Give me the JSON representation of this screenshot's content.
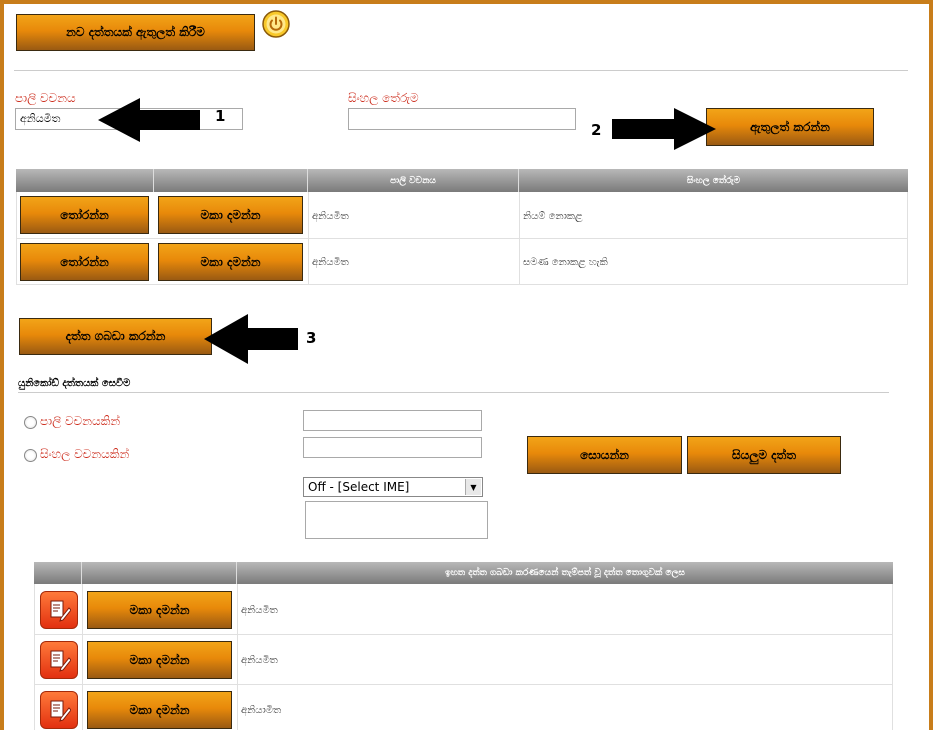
{
  "top": {
    "add_new_label": "නව දත්තයක් ඇතුලත් කිරීම"
  },
  "form": {
    "pali_label": "පාලි වචනය",
    "pali_value": "අනියමිත",
    "sinhala_label": "සිංහල තේරුම",
    "sinhala_value": "",
    "submit_label": "ඇතුලත් කරන්න"
  },
  "annotations": {
    "one": "1",
    "two": "2",
    "three": "3"
  },
  "table1": {
    "headers": [
      "",
      "",
      "පාලි වචනය",
      "සිංහල තේරුම"
    ],
    "select_label": "තෝරන්න",
    "delete_label": "මකා දමන්න",
    "rows": [
      {
        "pali": "අනියමිත",
        "sinhala": "නියම් නොකළ"
      },
      {
        "pali": "අනියමිත",
        "sinhala": "සමණ නොකළ හැකි"
      }
    ]
  },
  "save_label": "දත්ත ගබඩා කරන්න",
  "search": {
    "section_title": "යුනිකෝඩ් දත්තයක් සෙවීම",
    "radio_pali": "පාලි වචනයකින්",
    "radio_sinhala": "සිංහල වචනයකින්",
    "search_label": "සොයන්න",
    "all_data_label": "සියලුම දත්ත",
    "ime_selected": "Off - [Select IME]"
  },
  "table2": {
    "header": "ඉහත දත්ත ගබඩා කරණයෙන් තැම්පත් වූ දත්ත තොගුවක් ලෙස",
    "delete_label": "මකා දමන්න",
    "rows": [
      {
        "word": "අනියමිත"
      },
      {
        "word": "අනියමිත"
      },
      {
        "word": "අනියාමිත"
      }
    ]
  },
  "colors": {
    "accent": "#e8890a",
    "label_red": "#cc2a1a",
    "border": "#c87d1a"
  },
  "icons": [
    "power-icon",
    "arrow-left-icon",
    "arrow-right-icon",
    "edit-icon",
    "dropdown-arrow-icon"
  ]
}
